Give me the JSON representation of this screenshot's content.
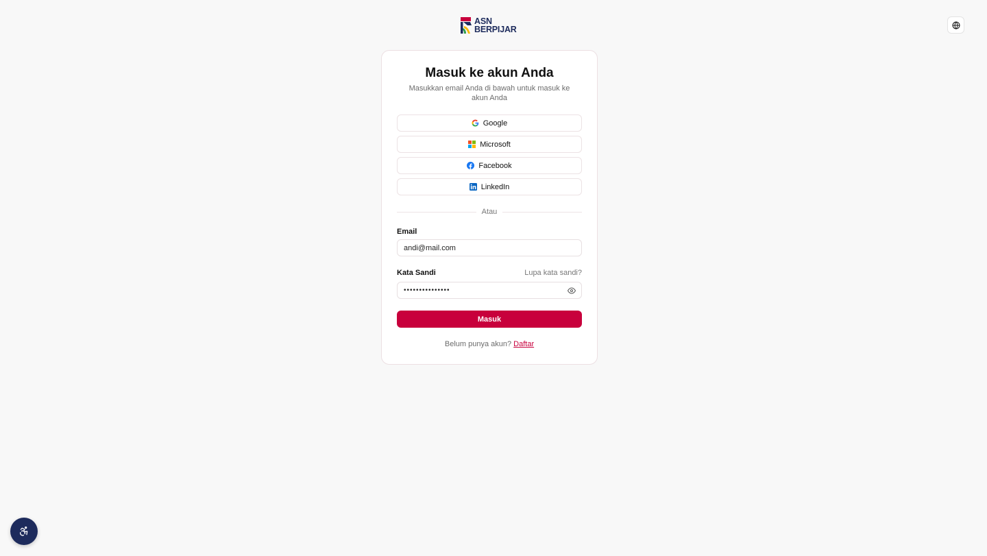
{
  "brand": {
    "line1": "ASN",
    "line2": "BERPIJAR",
    "colors": {
      "red": "#c8003c",
      "navy": "#1d2b5c",
      "yellow": "#f5b800"
    }
  },
  "header": {
    "language_icon": "globe-icon"
  },
  "login": {
    "title": "Masuk ke akun Anda",
    "subtitle": "Masukkan email Anda di bawah untuk masuk ke akun Anda",
    "social": [
      {
        "label": "Google",
        "icon": "google-icon"
      },
      {
        "label": "Microsoft",
        "icon": "microsoft-icon"
      },
      {
        "label": "Facebook",
        "icon": "facebook-icon"
      },
      {
        "label": "LinkedIn",
        "icon": "linkedin-icon"
      }
    ],
    "divider": "Atau",
    "email_label": "Email",
    "email_value": "andi@mail.com",
    "password_label": "Kata Sandi",
    "forgot_label": "Lupa kata sandi?",
    "password_value": "•••••••••••••••",
    "submit_label": "Masuk",
    "signup_prompt": "Belum punya akun?",
    "signup_link": "Daftar"
  },
  "accessibility": {
    "icon": "accessibility-icon"
  }
}
